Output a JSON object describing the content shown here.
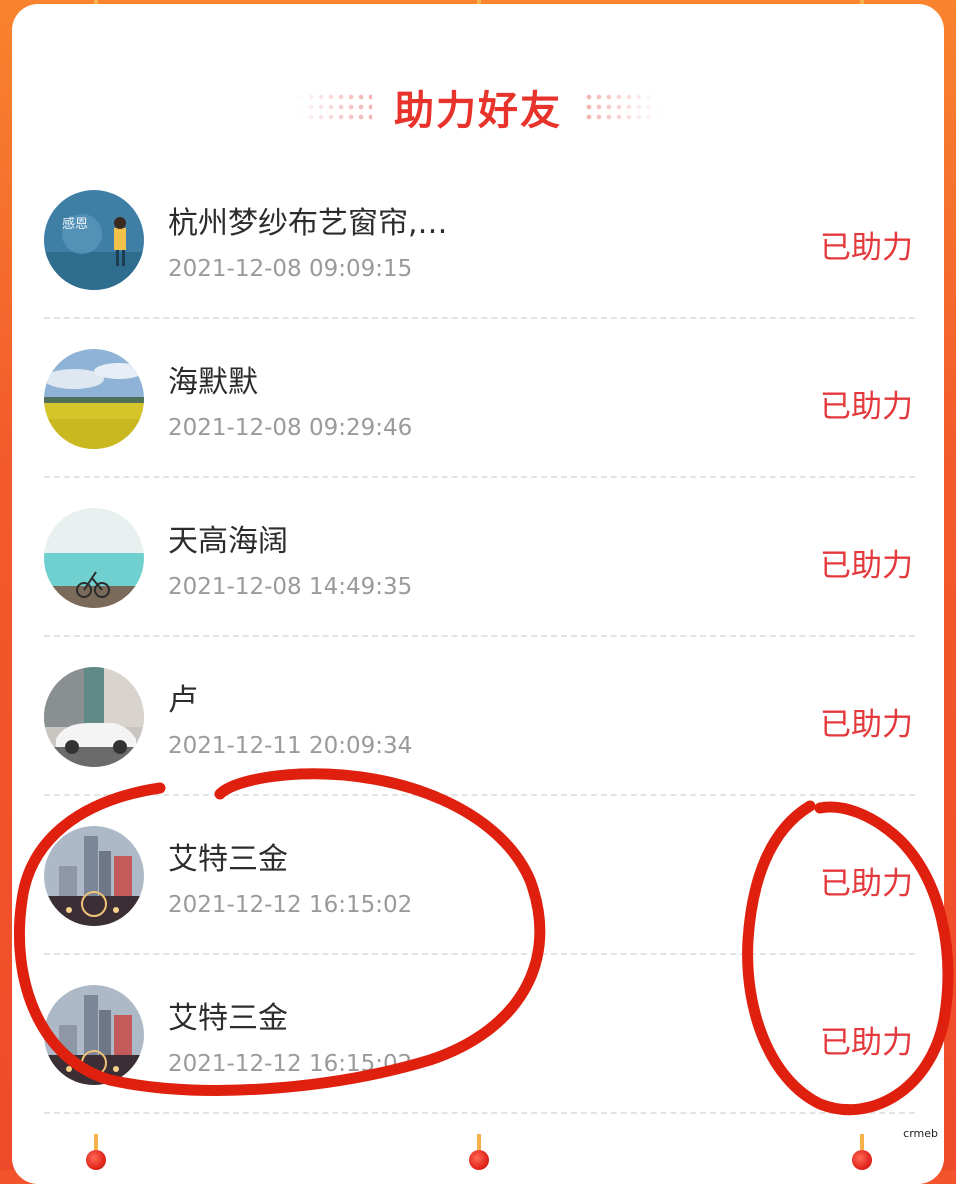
{
  "header": {
    "title": "助力好友"
  },
  "friends": [
    {
      "name": "杭州梦纱布艺窗帘,…",
      "time": "2021-12-08 09:09:15",
      "status": "已助力",
      "avatar_icon": "wall-graffiti-avatar"
    },
    {
      "name": "海默默",
      "time": "2021-12-08 09:29:46",
      "status": "已助力",
      "avatar_icon": "flower-field-avatar"
    },
    {
      "name": "天高海阔",
      "time": "2021-12-08 14:49:35",
      "status": "已助力",
      "avatar_icon": "sea-bicycle-avatar"
    },
    {
      "name": "卢",
      "time": "2021-12-11 20:09:34",
      "status": "已助力",
      "avatar_icon": "white-car-avatar"
    },
    {
      "name": "艾特三金",
      "time": "2021-12-12 16:15:02",
      "status": "已助力",
      "avatar_icon": "city-night-avatar"
    },
    {
      "name": "艾特三金",
      "time": "2021-12-12 16:15:02",
      "status": "已助力",
      "avatar_icon": "city-night-avatar"
    }
  ],
  "watermark": "crmeb",
  "colors": {
    "frame": "#f25a2b",
    "title": "#e7332c",
    "status": "#e4393c",
    "annotation": "#e0200e"
  }
}
